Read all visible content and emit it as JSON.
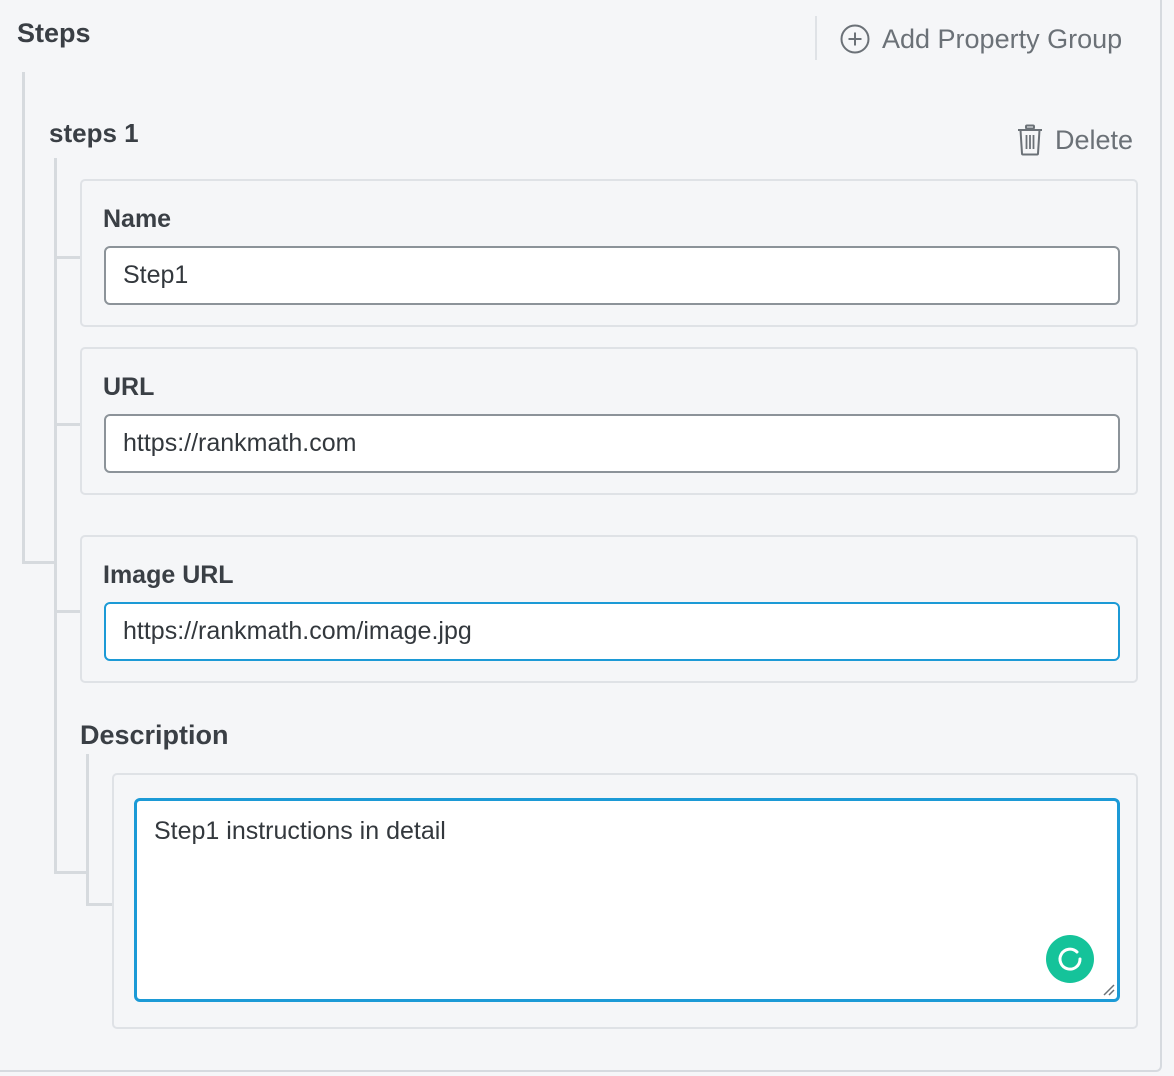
{
  "section": {
    "title": "Steps",
    "add_group_label": "Add Property Group"
  },
  "group": {
    "title": "steps 1",
    "delete_label": "Delete",
    "fields": {
      "name": {
        "label": "Name",
        "value": "Step1"
      },
      "url": {
        "label": "URL",
        "value": "https://rankmath.com"
      },
      "image_url": {
        "label": "Image URL",
        "value": "https://rankmath.com/image.jpg"
      },
      "description": {
        "label": "Description",
        "value": "Step1 instructions in detail"
      }
    }
  },
  "icons": {
    "add": "plus-circle-icon",
    "delete": "trash-icon",
    "grammar": "grammarly-icon",
    "resize": "resize-grip-icon"
  },
  "colors": {
    "background": "#f5f6f8",
    "focus_border": "#1c9ad6",
    "grammar_badge": "#15c39a",
    "text": "#33383d",
    "muted_text": "#6b7177"
  }
}
